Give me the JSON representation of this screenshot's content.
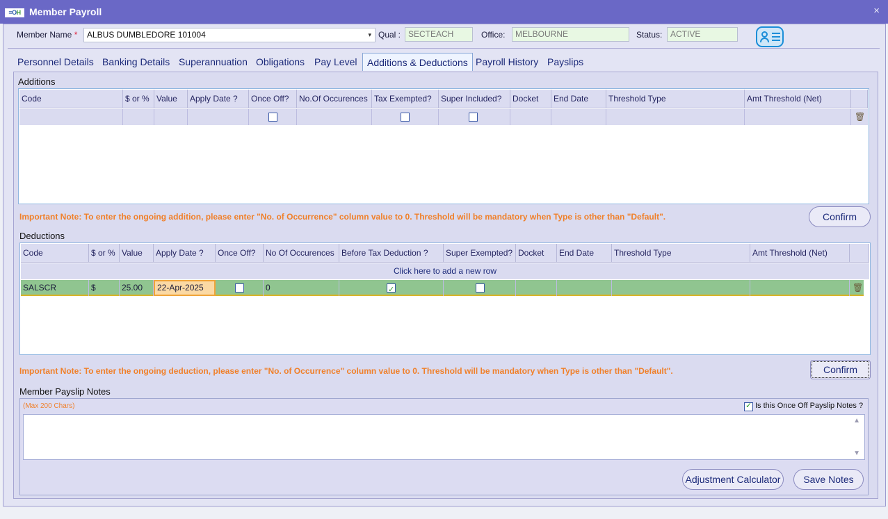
{
  "window": {
    "title": "Member Payroll",
    "logo_text_a": "≡O",
    "logo_text_b": "H",
    "close_glyph": "×"
  },
  "header": {
    "member_name_label": "Member Name",
    "required_mark": "*",
    "member_name_value": "ALBUS DUMBLEDORE 101004",
    "qual_label": "Qual :",
    "qual_value": "SECTEACH",
    "office_label": "Office:",
    "office_value": "MELBOURNE",
    "status_label": "Status:",
    "status_value": "ACTIVE",
    "card_icon": "member-card-icon"
  },
  "tabs": [
    "Personnel Details",
    "Banking Details",
    "Superannuation",
    "Obligations",
    "Pay Level",
    "Additions & Deductions",
    "Payroll History",
    "Payslips"
  ],
  "active_tab": "Additions & Deductions",
  "additions": {
    "title": "Additions",
    "columns": [
      "Code",
      "$ or %",
      "Value",
      "Apply Date ?",
      "Once Off?",
      "No.Of Occurences",
      "Tax Exempted?",
      "Super Included?",
      "Docket",
      "End Date",
      "Threshold Type",
      "Amt Threshold (Net)"
    ],
    "row": {
      "once_off": false,
      "tax_exempted": false,
      "super_included": false
    },
    "note": "Important Note: To enter the ongoing addition, please enter \"No. of Occurrence\" column value to 0. Threshold will be mandatory when Type is other than \"Default\".",
    "confirm_label": "Confirm"
  },
  "deductions": {
    "title": "Deductions",
    "columns": [
      "Code",
      "$ or %",
      "Value",
      "Apply Date ?",
      "Once Off?",
      "No Of Occurences",
      "Before Tax Deduction ?",
      "Super Exempted?",
      "Docket",
      "End Date",
      "Threshold Type",
      "Amt Threshold (Net)"
    ],
    "add_row_text": "Click here to add a new row",
    "rows": [
      {
        "code": "SALSCR",
        "type": "$",
        "value": "25.00",
        "apply_date": "22-Apr-2025",
        "once_off": false,
        "occurrences": "0",
        "before_tax": true,
        "super_exempted": false,
        "docket": "",
        "end_date": "",
        "threshold_type": "",
        "amt_threshold": ""
      }
    ],
    "note": "Important Note: To enter the ongoing deduction, please enter \"No. of Occurrence\" column value to 0.  Threshold will be mandatory when Type is other than \"Default\".",
    "confirm_label": "Confirm"
  },
  "payslip_notes": {
    "title": "Member Payslip Notes",
    "max_chars": "(Max 200 Chars)",
    "once_off_label": "Is this Once Off Payslip Notes ?",
    "once_off_checked": true,
    "text": "",
    "adjustment_label": "Adjustment Calculator",
    "save_label": "Save Notes"
  },
  "colors": {
    "title_bar": "#6a68c6",
    "row_green": "#90c590",
    "note_orange": "#f0802a",
    "selected_cell": "#fbd9a4"
  }
}
